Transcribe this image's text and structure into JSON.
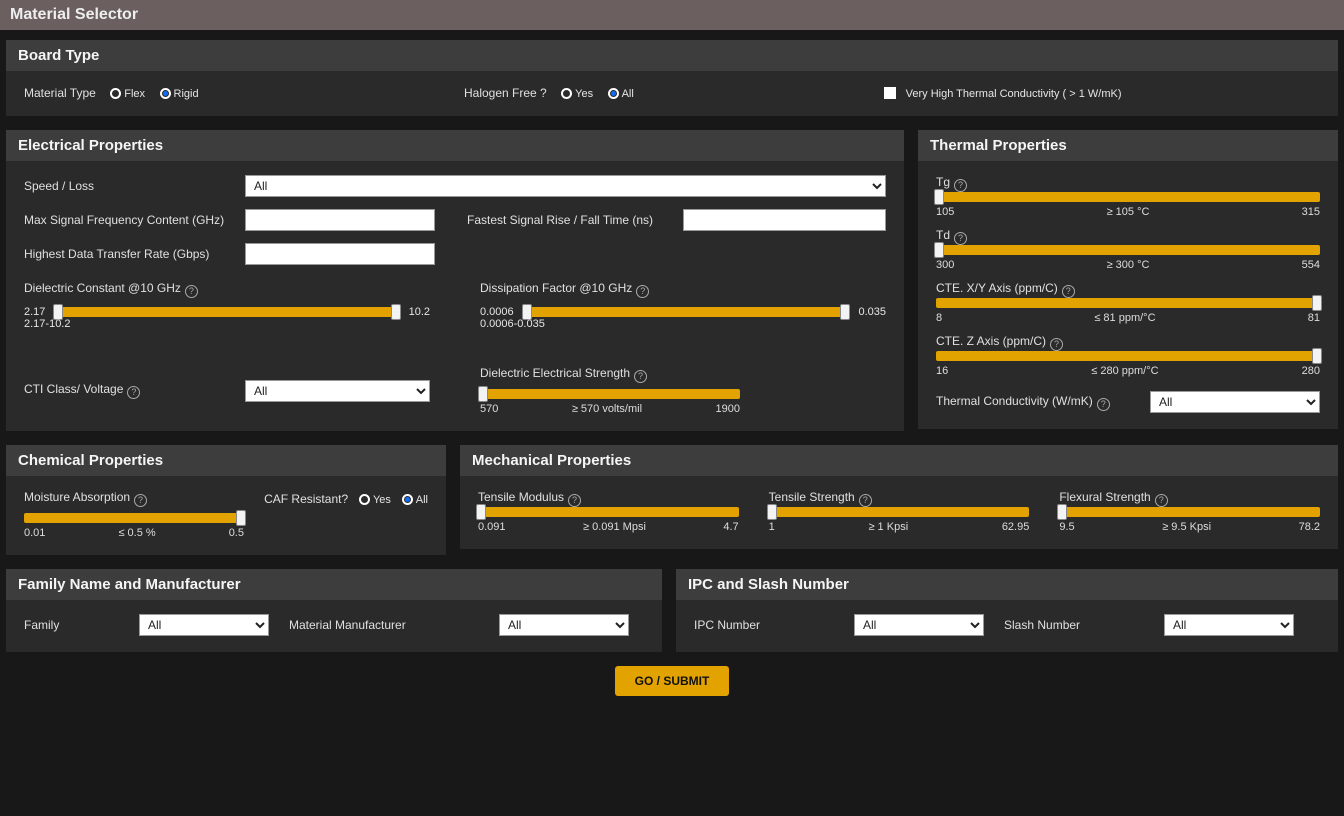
{
  "page_title": "Material Selector",
  "board_type": {
    "title": "Board Type",
    "material_type_label": "Material Type",
    "opt_flex": "Flex",
    "opt_rigid": "Rigid",
    "halogen_label": "Halogen Free ?",
    "opt_yes": "Yes",
    "opt_all": "All",
    "thermal_check_label": "Very High Thermal Conductivity ( > 1 W/mK)"
  },
  "electrical": {
    "title": "Electrical Properties",
    "speed_loss_label": "Speed / Loss",
    "speed_loss_value": "All",
    "max_sig_label": "Max Signal Frequency Content (GHz)",
    "fastest_label": "Fastest Signal Rise / Fall Time (ns)",
    "highest_label": "Highest Data Transfer Rate (Gbps)",
    "dk_label": "Dielectric Constant @10 GHz",
    "dk_min": "2.17",
    "dk_max": "10.2",
    "dk_range": "2.17-10.2",
    "df_label": "Dissipation Factor @10 GHz",
    "df_min": "0.0006",
    "df_max": "0.035",
    "df_range": "0.0006-0.035",
    "cti_label": "CTI Class/ Voltage",
    "cti_value": "All",
    "des_label": "Dielectric Electrical Strength",
    "des_min": "570",
    "des_mid": "≥  570 volts/mil",
    "des_max": "1900"
  },
  "thermal": {
    "title": "Thermal Properties",
    "tg_label": "Tg",
    "tg_min": "105",
    "tg_mid": "≥ 105 °C",
    "tg_max": "315",
    "td_label": "Td",
    "td_min": "300",
    "td_mid": "≥ 300 °C",
    "td_max": "554",
    "ctexy_label": "CTE. X/Y Axis (ppm/C)",
    "ctexy_min": "8",
    "ctexy_mid": "≤ 81 ppm/°C",
    "ctexy_max": "81",
    "ctez_label": "CTE. Z Axis (ppm/C)",
    "ctez_min": "16",
    "ctez_mid": "≤ 280 ppm/°C",
    "ctez_max": "280",
    "tc_label": "Thermal Conductivity (W/mK)",
    "tc_value": "All"
  },
  "chemical": {
    "title": "Chemical Properties",
    "moist_label": "Moisture Absorption",
    "moist_min": "0.01",
    "moist_mid": "≤ 0.5 %",
    "moist_max": "0.5",
    "caf_label": "CAF Resistant?",
    "opt_yes": "Yes",
    "opt_all": "All"
  },
  "mechanical": {
    "title": "Mechanical Properties",
    "tm_label": "Tensile Modulus",
    "tm_min": "0.091",
    "tm_mid": "≥ 0.091 Mpsi",
    "tm_max": "4.7",
    "ts_label": "Tensile Strength",
    "ts_min": "1",
    "ts_mid": "≥ 1 Kpsi",
    "ts_max": "62.95",
    "fs_label": "Flexural Strength",
    "fs_min": "9.5",
    "fs_mid": "≥ 9.5 Kpsi",
    "fs_max": "78.2"
  },
  "family": {
    "title": "Family Name and Manufacturer",
    "family_label": "Family",
    "family_value": "All",
    "manu_label": "Material Manufacturer",
    "manu_value": "All"
  },
  "ipc": {
    "title": "IPC and Slash Number",
    "ipc_label": "IPC Number",
    "ipc_value": "All",
    "slash_label": "Slash Number",
    "slash_value": "All"
  },
  "submit_label": "GO / SUBMIT"
}
